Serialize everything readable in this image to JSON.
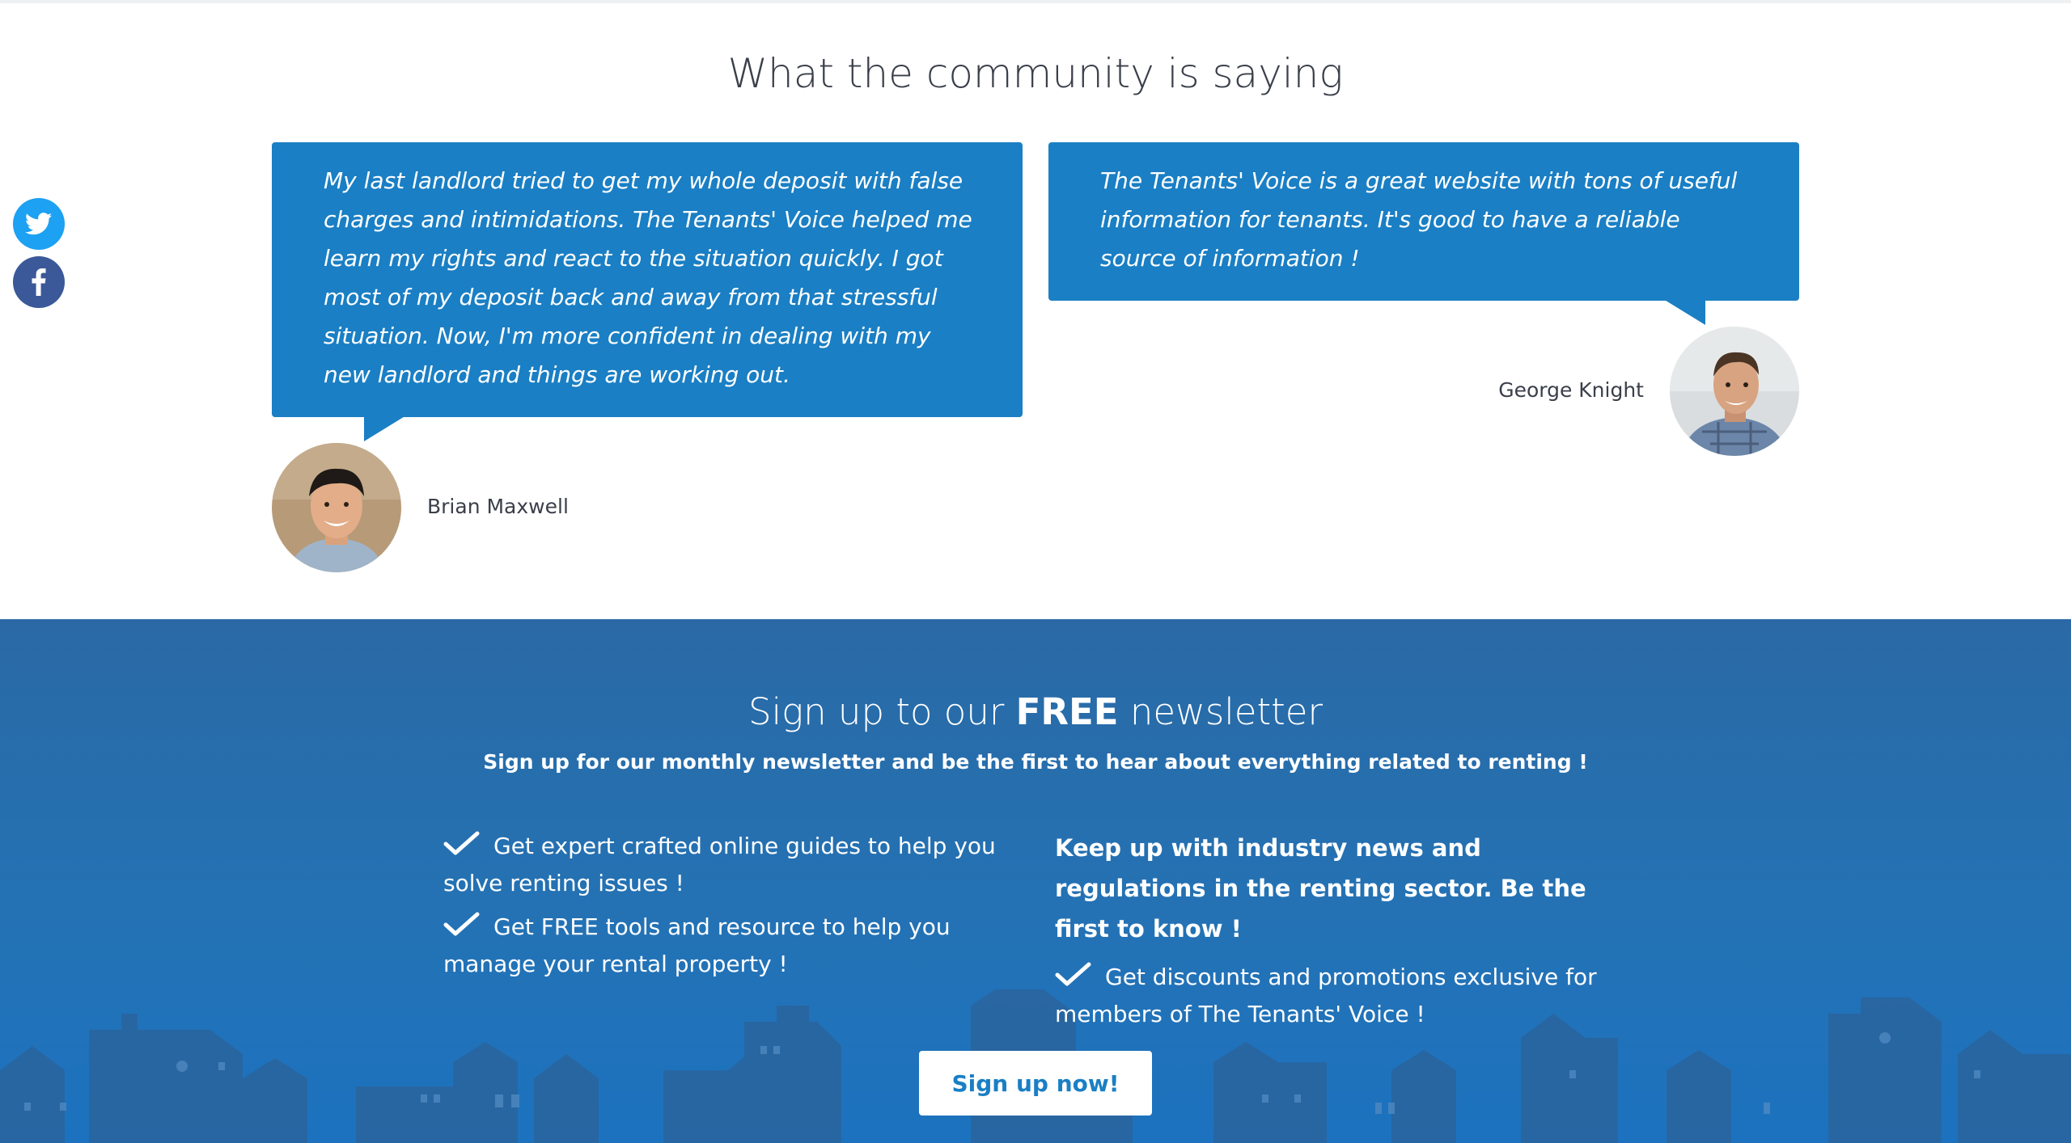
{
  "social": {
    "twitter_icon": "twitter-icon",
    "facebook_icon": "facebook-icon"
  },
  "testimonials": {
    "title": "What the community is saying",
    "items": [
      {
        "quote": "My last landlord tried to get my whole deposit with false charges and intimidations. The Tenants' Voice helped me learn my rights and react to the situation quickly. I got most of my deposit back and away from that stressful situation. Now, I'm more confident in dealing with my new landlord and things are working out.",
        "name": "Brian Maxwell"
      },
      {
        "quote": "The Tenants' Voice is a great website with tons of useful information for tenants. It's good to have a reliable source of information !",
        "name": "George Knight"
      }
    ]
  },
  "newsletter": {
    "title_pre": "Sign up to our ",
    "title_bold": "FREE",
    "title_post": " newsletter",
    "subtitle": "Sign up for our monthly newsletter and be the first to hear about everything related to renting !",
    "left_items": [
      "Get expert crafted online guides to help you solve renting issues !",
      "Get FREE tools and resource to help you manage your rental property !"
    ],
    "right_lead": "Keep up with industry news and regulations in the renting sector. Be the first to know !",
    "right_items": [
      "Get discounts and promotions exclusive for members of The Tenants' Voice !"
    ],
    "button_label": "Sign up now!"
  },
  "colors": {
    "bubble": "#1a7fc4",
    "newsletter_bg": "#2472b4",
    "twitter": "#1da1f2",
    "facebook": "#3b5998",
    "button_text": "#1a7fc4"
  }
}
